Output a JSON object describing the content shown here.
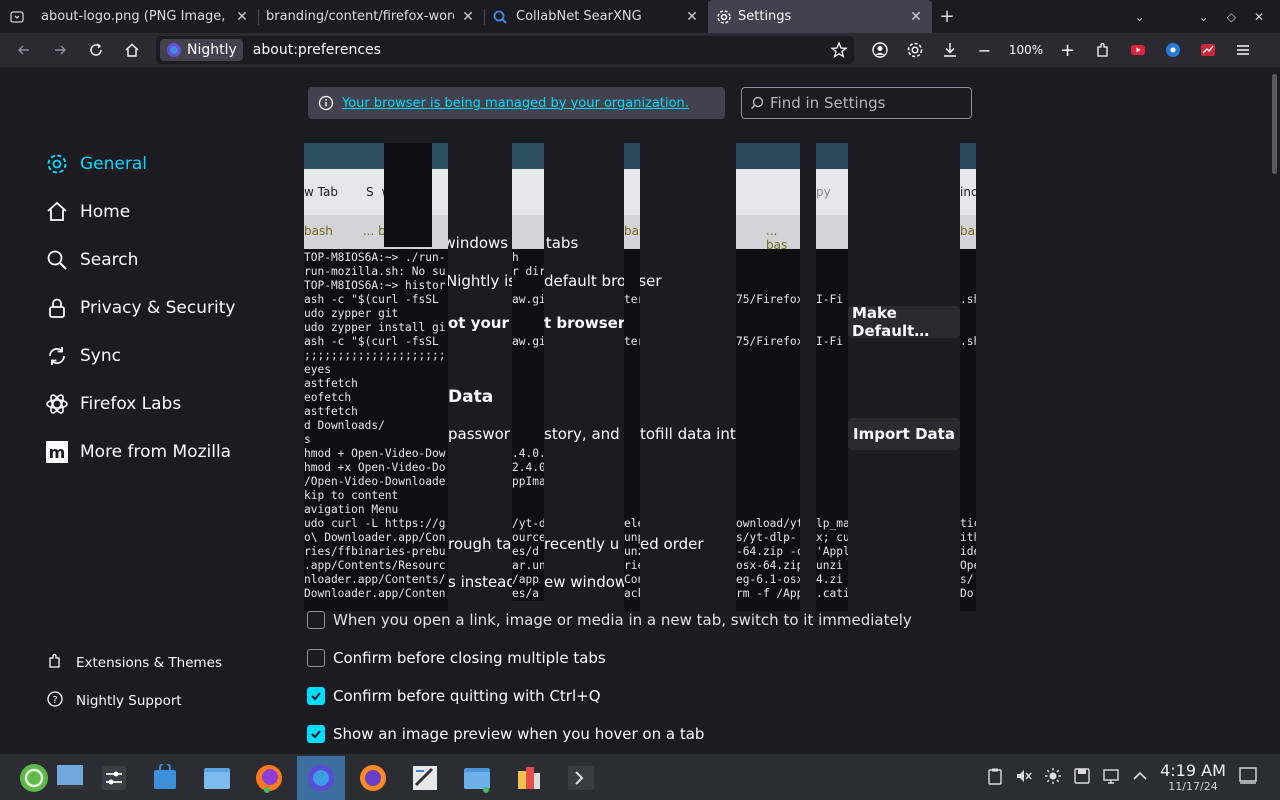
{
  "tabs": [
    {
      "title": "about-logo.png (PNG Image, 1",
      "active": false
    },
    {
      "title": "branding/content/firefox-word",
      "active": false
    },
    {
      "title": "CollabNet SearXNG",
      "active": false
    },
    {
      "title": "Settings",
      "active": true
    }
  ],
  "navbar": {
    "identity_label": "Nightly",
    "url": "about:preferences",
    "zoom": "100%"
  },
  "policy": {
    "text": "Your browser is being managed by your organization."
  },
  "search": {
    "placeholder": "Find in Settings"
  },
  "sidebar": {
    "categories": [
      {
        "label": "General",
        "icon": "gear-icon",
        "selected": true
      },
      {
        "label": "Home",
        "icon": "home-icon"
      },
      {
        "label": "Search",
        "icon": "search-icon"
      },
      {
        "label": "Privacy & Security",
        "icon": "lock-icon"
      },
      {
        "label": "Sync",
        "icon": "sync-icon"
      },
      {
        "label": "Firefox Labs",
        "icon": "labs-icon"
      },
      {
        "label": "More from Mozilla",
        "icon": "mozilla-icon"
      }
    ],
    "footer": [
      {
        "label": "Extensions & Themes",
        "icon": "puzzle-icon"
      },
      {
        "label": "Nightly Support",
        "icon": "help-icon"
      }
    ]
  },
  "content": {
    "startup_fragment": "revious windows and tabs",
    "default_fragment_a": "Nightly is",
    "default_fragment_b": "default browser",
    "not_default_a": "ot your de",
    "not_default_b": "t browser",
    "make_default": "Make Default…",
    "import_heading": "Data",
    "import_desc_a": "passwor",
    "import_desc_b": "story, and a",
    "import_desc_c": "tofill data into",
    "import_button": "Import Data",
    "ctrl_tab_a": "rough ta",
    "ctrl_tab_b": "recently u",
    "ctrl_tab_c": "ed order",
    "links_a": "s instead",
    "links_b": "ew window"
  },
  "checkboxes": [
    {
      "label": "When you open a link, image or media in a new tab, switch to it immediately",
      "checked": false
    },
    {
      "label": "Confirm before closing multiple tabs",
      "checked": false
    },
    {
      "label": "Confirm before quitting with Ctrl+Q",
      "checked": true
    },
    {
      "label": "Show an image preview when you hover on a tab",
      "checked": true
    }
  ],
  "glitch": {
    "tab_fragments": [
      "w Tab",
      "S",
      "w",
      "bash",
      "... b",
      "bash",
      "... bas",
      "bash",
      "bash",
      "py",
      "ind"
    ],
    "terminal_lines": [
      "TOP-M8IOS6A:~> ./run-",
      "run-mozilla.sh: No su",
      "TOP-M8IOS6A:~> histor",
      "ash -c \"$(curl -fsSL",
      "udo zypper git",
      "udo zypper install gi",
      "ash -c \"$(curl -fsSL",
      ";;;;;;;;;;;;;;;;;;;;;",
      "eyes",
      "astfetch",
      "eofetch",
      "astfetch",
      "d Downloads/",
      "s",
      "hmod + Open-Video-Dow",
      "hmod +x Open-Video-Do",
      "/Open-Video-Downloade",
      "kip to content",
      "avigation Menu",
      "udo curl -L https://g",
      "o\\ Downloader.app/Con",
      "ries/ffbinaries-prebu",
      ".app/Contents/Resourc",
      "nloader.app/Contents/",
      "Downloader.app/Conten"
    ],
    "strip2_lines": [
      "h",
      "r dir",
      "",
      "aw.gi",
      "",
      "",
      "aw.gi",
      "",
      "",
      "",
      "",
      "",
      "",
      "",
      ".4.0.",
      "2.4.0",
      "ppIma",
      "",
      "",
      "/yt-d",
      "ource",
      "es/d",
      "ar.un",
      "/app",
      "es/a"
    ],
    "strip3_lines": [
      "",
      "",
      "",
      "ter",
      "",
      "",
      "ter",
      "",
      "",
      "",
      "",
      "",
      "",
      "",
      "",
      "",
      "",
      "",
      "",
      "ele",
      "unp",
      "unz",
      "rie",
      "Con",
      "ack"
    ],
    "strip4_lines": [
      "",
      "",
      "",
      "75/Firefox",
      "",
      "",
      "75/Firefox",
      "",
      "",
      "",
      "",
      "",
      "",
      "",
      "",
      "",
      "",
      "",
      "",
      "ownload/yt",
      "s/yt-dlp-",
      "-64.zip -c",
      "osx-64.zip",
      "eg-6.1-osx",
      "rm -f /App"
    ],
    "strip5_lines": [
      "",
      "",
      "",
      "I-Fi",
      "",
      "",
      "I-Fi",
      "",
      "",
      "",
      "",
      "",
      "",
      "",
      "",
      "",
      "",
      "",
      "",
      "lp_ma",
      "x; cu",
      "'Appl",
      "unzi",
      "4.zi",
      ".cati"
    ],
    "strip6_lines": [
      "",
      "",
      "",
      ".sh",
      "",
      "",
      ".sh",
      "",
      "",
      "",
      "",
      "",
      "",
      "",
      "",
      "",
      "",
      "",
      "",
      "tic",
      "ith",
      "ide",
      "Ope",
      "s/",
      "Do"
    ]
  },
  "taskbar": {
    "time": "4:19 AM",
    "date": "11/17/24"
  },
  "colors": {
    "accent": "#00ddff",
    "background": "#1c1b22",
    "toolbar": "#2b2a33"
  }
}
